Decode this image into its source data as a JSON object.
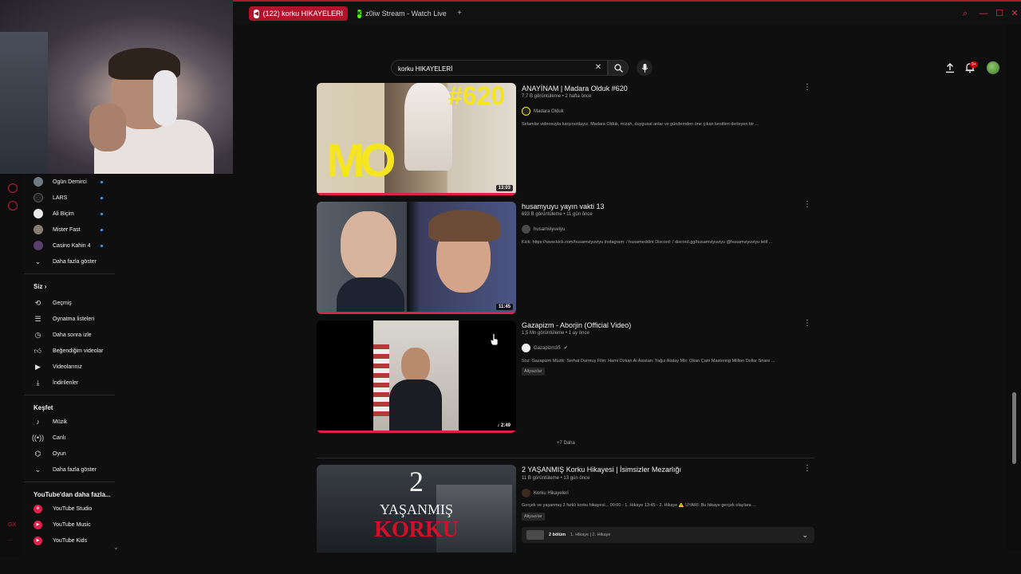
{
  "browser": {
    "tabs": [
      {
        "label": "(122) korku HIKAYELERI",
        "active": true
      },
      {
        "label": "z0iw Stream - Watch Live",
        "active": false
      }
    ],
    "accent": "#b3122d"
  },
  "header": {
    "search_value": "korku HIKAYELERİ",
    "notif_count": "9+"
  },
  "sidebar": {
    "subscriptions": [
      {
        "label": "Ogün Demirci"
      },
      {
        "label": "LARS"
      },
      {
        "label": "Ali Biçim"
      },
      {
        "label": "Mister Fast"
      },
      {
        "label": "Casino Kahin 4"
      }
    ],
    "subs_more": "Daha fazla göster",
    "you_heading": "Siz",
    "you_items": [
      {
        "label": "Geçmiş"
      },
      {
        "label": "Oynatma listeleri"
      },
      {
        "label": "Daha sonra izle"
      },
      {
        "label": "Beğendiğim videolar"
      },
      {
        "label": "Videolarınız"
      },
      {
        "label": "İndirilenler"
      }
    ],
    "explore_heading": "Keşfet",
    "explore_items": [
      {
        "label": "Müzik"
      },
      {
        "label": "Canlı"
      },
      {
        "label": "Oyun"
      }
    ],
    "explore_more": "Daha fazla göster",
    "more_heading": "YouTube'dan daha fazla...",
    "more_items": [
      {
        "label": "YouTube Studio"
      },
      {
        "label": "YouTube Music"
      },
      {
        "label": "YouTube Kids"
      }
    ],
    "rail_texts": [
      "GX",
      "..."
    ]
  },
  "results": [
    {
      "title": "ANAYİNAM | Madara Olduk #620",
      "meta": "7,7 B görüntüleme • 2 hafta önce",
      "channel": "Madara Olduk",
      "desc": "Selamlar videosuyla karşınızdayız. Madara Olduk, mizah, duygusal anlar ve gündemden öne çıkan kesitleri derleyen bir ...",
      "duration": "13:03",
      "thumb_text": "#620",
      "thumb_logo": "MO"
    },
    {
      "title": "husamyuyu yayın vakti 13",
      "meta": "693 B görüntüleme • 11 gün önce",
      "channel": "husamviyuviyu",
      "desc": "Kick: https://www.kick.com/husamviyuviyu Instagram: / husameddint Discord: / discord.gg/husamviyuviyu @husamviyuviyu telif ...",
      "duration": "11:45"
    },
    {
      "title": "Gazapizm - Aborjin (Official Video)",
      "meta": "1,5 Mn görüntüleme • 1 ay önce",
      "channel": "Gazapizm35",
      "desc": "Söz: Gazapizm Müzik: Serhat Durmuş Film: Hami Özkan Ai Asistan: Yağız Atalay Mix: Okan Çam Mastering Million Dollar Snare ...",
      "badge": "Altyazılar",
      "duration": "2:49"
    },
    {
      "title": "2 YAŞANMIŞ Korku Hikayesi | İsimsizler Mezarlığı",
      "meta": "11 B görüntüleme • 13 gün önce",
      "channel": "Korku Hikayeleri",
      "desc": "Gerçek ve yaşanmış 2 farklı korku hikayesi... 00:00 - 1. Hikaye 13:45 - 2. Hikaye ⚠️ UYARI: Bu hikaye gerçek olaylara ...",
      "badge": "Altyazılar",
      "thumb_num": "2",
      "thumb_line1": "YAŞANMIŞ",
      "thumb_line2": "KORKU",
      "chapters_count": "2 bölüm",
      "chapters_text": "1. Hikaye | 2. Hikaye"
    }
  ],
  "more_link": "+7 Daha"
}
